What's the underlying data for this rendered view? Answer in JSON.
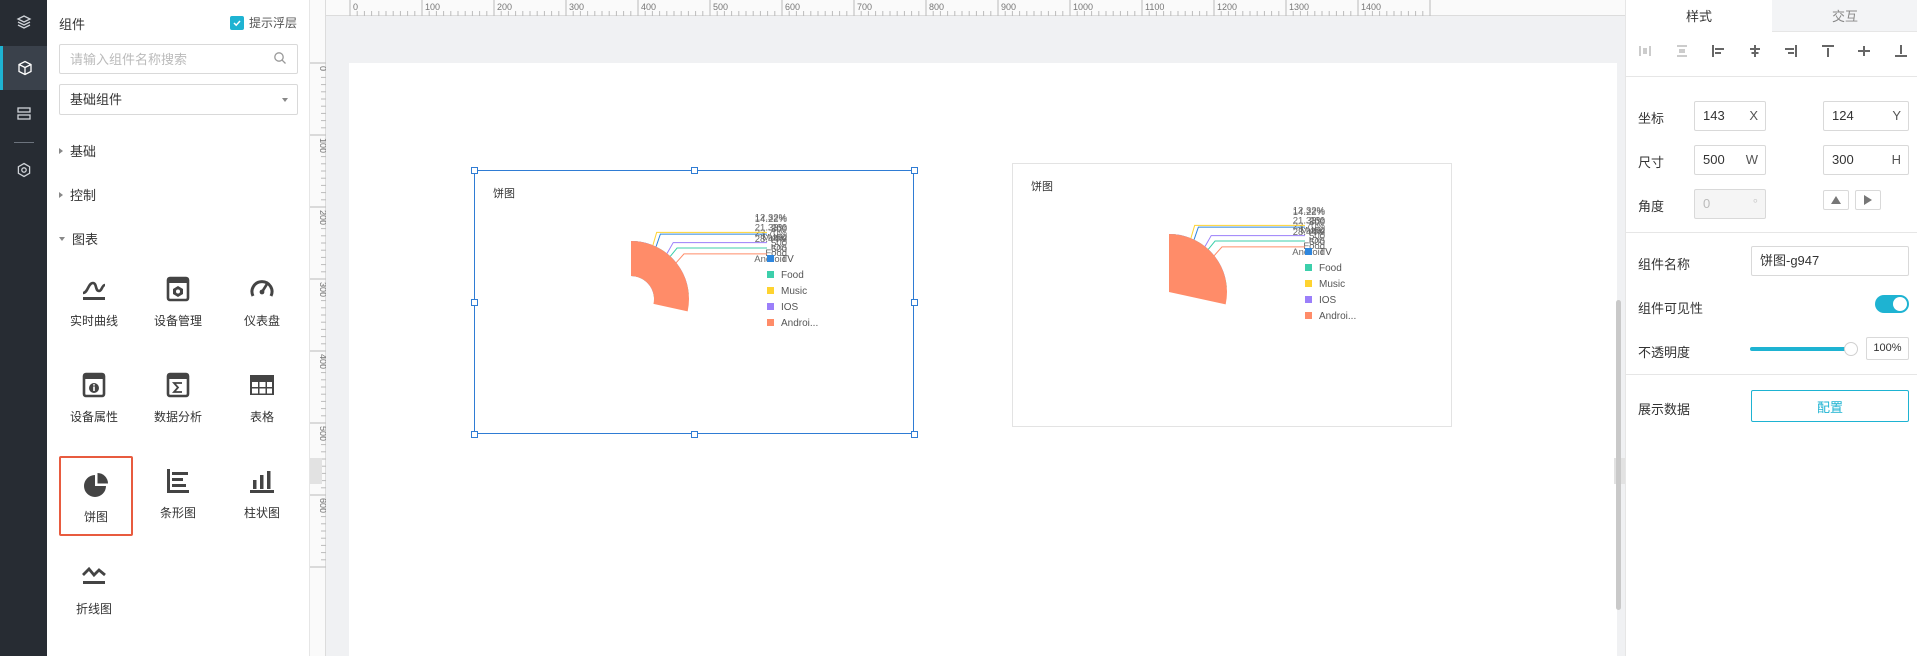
{
  "rail": {
    "items": [
      {
        "icon": "layers-icon"
      },
      {
        "icon": "cube-icon"
      },
      {
        "icon": "stack-icon"
      },
      {
        "icon": "settings-icon"
      }
    ]
  },
  "panel": {
    "title": "组件",
    "float_layer_label": "提示浮层",
    "search_placeholder": "请输入组件名称搜索",
    "category_selected": "基础组件",
    "groups": {
      "basic": "基础",
      "control": "控制",
      "chart": "图表"
    },
    "components": [
      {
        "label": "实时曲线",
        "icon": "realtime-curve-icon"
      },
      {
        "label": "设备管理",
        "icon": "device-manage-icon"
      },
      {
        "label": "仪表盘",
        "icon": "gauge-icon"
      },
      {
        "label": "设备属性",
        "icon": "device-property-icon"
      },
      {
        "label": "数据分析",
        "icon": "data-analysis-icon"
      },
      {
        "label": "表格",
        "icon": "table-icon"
      },
      {
        "label": "饼图",
        "icon": "pie-chart-icon"
      },
      {
        "label": "条形图",
        "icon": "bar-chart-horizontal-icon"
      },
      {
        "label": "柱状图",
        "icon": "column-chart-icon"
      },
      {
        "label": "折线图",
        "icon": "line-chart-icon"
      }
    ]
  },
  "ruler": {
    "x_ticks": [
      "0",
      "100",
      "200",
      "300",
      "400",
      "500",
      "600",
      "700",
      "800",
      "900",
      "1000",
      "1100",
      "1200",
      "1300",
      "1400"
    ],
    "y_ticks": [
      "0",
      "100",
      "200",
      "300",
      "400",
      "500",
      "600"
    ]
  },
  "chart_data": [
    {
      "type": "pie",
      "variant": "donut",
      "title": "饼图",
      "categories": [
        "TV",
        "Food",
        "Music",
        "IOS",
        "Android"
      ],
      "values": [
        300,
        500,
        260,
        450,
        600
      ],
      "percent_labels": [
        "14.22%",
        "23.70%",
        "12.32%",
        "21.33%",
        "28.44%"
      ],
      "legend_labels": [
        "TV",
        "Food",
        "Music",
        "IOS",
        "Androi..."
      ],
      "colors": [
        "#2e86de",
        "#3ccfab",
        "#fed330",
        "#9b7ffa",
        "#ff8c69"
      ],
      "legend_position": "right"
    },
    {
      "type": "pie",
      "title": "饼图",
      "categories": [
        "TV",
        "Food",
        "Music",
        "IOS",
        "Android"
      ],
      "values": [
        300,
        500,
        260,
        450,
        600
      ],
      "percent_labels": [
        "14.22%",
        "23.70%",
        "12.32%",
        "21.33%",
        "28.44%"
      ],
      "legend_labels": [
        "TV",
        "Food",
        "Music",
        "IOS",
        "Androi..."
      ],
      "colors": [
        "#2e86de",
        "#3ccfab",
        "#fed330",
        "#9b7ffa",
        "#ff8c69"
      ],
      "legend_position": "right"
    }
  ],
  "props": {
    "tabs": [
      "样式",
      "交互"
    ],
    "coord_label": "坐标",
    "x_value": "143",
    "x_unit": "X",
    "y_value": "124",
    "y_unit": "Y",
    "size_label": "尺寸",
    "w_value": "500",
    "w_unit": "W",
    "h_value": "300",
    "h_unit": "H",
    "angle_label": "角度",
    "angle_value": "0",
    "angle_unit": "°",
    "name_label": "组件名称",
    "name_value": "饼图-g947",
    "visible_label": "组件可见性",
    "visible": true,
    "opacity_label": "不透明度",
    "opacity_value": "100%",
    "data_label": "展示数据",
    "config_button": "配置"
  }
}
